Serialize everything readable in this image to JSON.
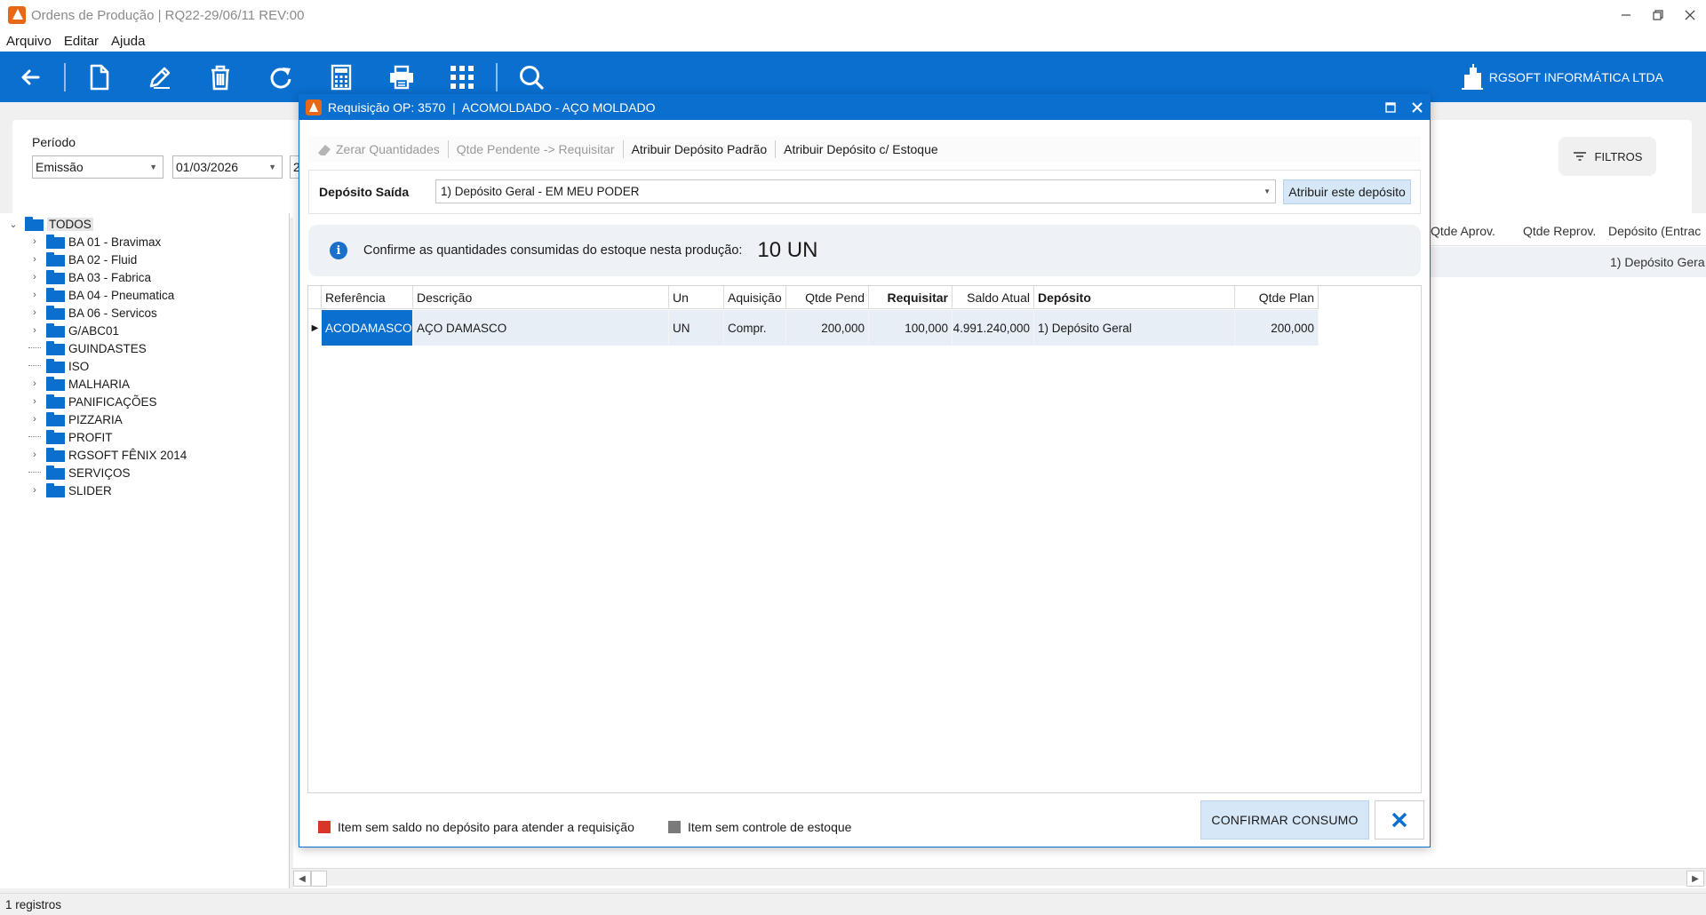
{
  "window": {
    "title": "Ordens de Produção | RQ22-29/06/11 REV:00"
  },
  "menu": [
    "Arquivo",
    "Editar",
    "Ajuda"
  ],
  "toolbar": {
    "buttons": [
      "back-arrow-icon",
      "new-document-icon",
      "edit-pencil-icon",
      "trash-icon",
      "refresh-icon",
      "calculator-icon",
      "printer-icon",
      "grid-apps-icon",
      "search-icon"
    ],
    "company": "RGSOFT INFORMÁTICA LTDA"
  },
  "filters": {
    "periodo_label": "Período",
    "periodo_type": "Emissão",
    "date_from": "01/03/2026",
    "date_to_partial": "2",
    "filtros_label": "FILTROS"
  },
  "tree": {
    "root": "TODOS",
    "items": [
      {
        "label": "BA 01 - Bravimax",
        "expandable": true
      },
      {
        "label": "BA 02 - Fluid",
        "expandable": true
      },
      {
        "label": "BA 03 - Fabrica",
        "expandable": true
      },
      {
        "label": "BA 04 - Pneumatica",
        "expandable": true
      },
      {
        "label": "BA 06 - Servicos",
        "expandable": true
      },
      {
        "label": "G/ABC01",
        "expandable": true
      },
      {
        "label": "GUINDASTES",
        "expandable": false
      },
      {
        "label": "ISO",
        "expandable": false
      },
      {
        "label": "MALHARIA",
        "expandable": true
      },
      {
        "label": "PANIFICAÇÕES",
        "expandable": true
      },
      {
        "label": "PIZZARIA",
        "expandable": true
      },
      {
        "label": "PROFIT",
        "expandable": false
      },
      {
        "label": "RGSOFT FÊNIX 2014",
        "expandable": true
      },
      {
        "label": "SERVIÇOS",
        "expandable": false
      },
      {
        "label": "SLIDER",
        "expandable": true
      }
    ]
  },
  "background_grid": {
    "headers": [
      "Qtde Aprov.",
      "Qtde Reprov.",
      "Depósito (Entrac"
    ],
    "row": {
      "deposito": "1) Depósito Gera"
    }
  },
  "status": {
    "records": "1 registros"
  },
  "dialog": {
    "title": "Requisição OP: 3570  |  ACOMOLDADO - AÇO MOLDADO",
    "actions": {
      "zerar": "Zerar Quantidades",
      "pendente": "Qtde Pendente -> Requisitar",
      "padrao": "Atribuir Depósito Padrão",
      "estoque": "Atribuir Depósito c/ Estoque"
    },
    "deposito_label": "Depósito Saída",
    "deposito_value": "1) Depósito Geral - EM MEU PODER",
    "deposito_button": "Atribuir este depósito",
    "info_text": "Confirme as quantidades consumidas do estoque nesta produção:",
    "info_qty": "10 UN",
    "grid": {
      "headers": {
        "referencia": "Referência",
        "descricao": "Descrição",
        "un": "Un",
        "aquisicao": "Aquisição",
        "qtde_pend": "Qtde Pend",
        "requisitar": "Requisitar",
        "saldo_atual": "Saldo Atual",
        "deposito": "Depósito",
        "qtde_plan": "Qtde Plan"
      },
      "row": {
        "referencia": "ACODAMASCO",
        "descricao": "AÇO DAMASCO",
        "un": "UN",
        "aquisicao": "Compr.",
        "qtde_pend": "200,000",
        "requisitar": "100,000",
        "saldo_atual": "4.991.240,000",
        "deposito": "1) Depósito Geral",
        "qtde_plan": "200,000"
      }
    },
    "legend": {
      "red": "Item sem saldo no depósito para atender a requisição",
      "gray": "Item sem controle de estoque"
    },
    "confirm_button": "CONFIRMAR CONSUMO",
    "colors": {
      "accent": "#0a6fcf",
      "legend_red": "#d9362b",
      "legend_gray": "#7a7a7a"
    }
  }
}
